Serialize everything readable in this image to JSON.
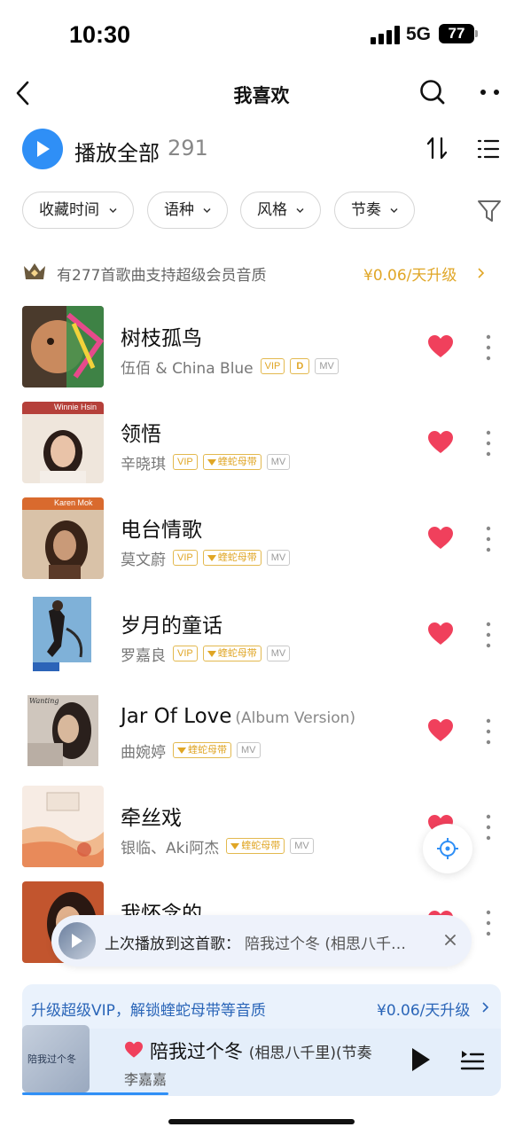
{
  "status_bar": {
    "time": "10:30",
    "network": "5G",
    "battery": "77"
  },
  "nav": {
    "title": "我喜欢",
    "back_icon": "chevron-left-icon",
    "search_icon": "search-icon",
    "more_icon": "more-dots-icon"
  },
  "play_all": {
    "label": "播放全部",
    "count": "291"
  },
  "filters": [
    {
      "label": "收藏时间"
    },
    {
      "label": "语种"
    },
    {
      "label": "风格"
    },
    {
      "label": "节奏"
    }
  ],
  "promo": {
    "text": "有277首歌曲支持超级会员音质",
    "price": "¥0.06/天升级"
  },
  "songs": [
    {
      "title": "树枝孤鸟",
      "version": "",
      "artist": "伍佰 & China Blue",
      "vip": "VIP",
      "quality": "",
      "dolby": "D",
      "mv": "MV"
    },
    {
      "title": "领悟",
      "version": "",
      "artist": "辛晓琪",
      "vip": "VIP",
      "quality": "蝰蛇母带",
      "mv": "MV"
    },
    {
      "title": "电台情歌",
      "version": "",
      "artist": "莫文蔚",
      "vip": "VIP",
      "quality": "蝰蛇母带",
      "mv": "MV"
    },
    {
      "title": "岁月的童话",
      "version": "",
      "artist": "罗嘉良",
      "vip": "VIP",
      "quality": "蝰蛇母带",
      "mv": "MV"
    },
    {
      "title": "Jar Of Love",
      "version": "(Album Version)",
      "artist": "曲婉婷",
      "vip": "",
      "quality": "蝰蛇母带",
      "mv": "MV"
    },
    {
      "title": "牵丝戏",
      "version": "",
      "artist": "银临、Aki阿杰",
      "vip": "",
      "quality": "蝰蛇母带",
      "mv": "MV"
    },
    {
      "title": "我怀念的",
      "version": "",
      "artist": "",
      "vip": "",
      "quality": "",
      "mv": ""
    }
  ],
  "cover_labels": {
    "song2": "Winnie Hsin",
    "song3": "Karen Mok",
    "song5": "Wanting"
  },
  "toast": {
    "label": "上次播放到这首歌：",
    "song": "陪我过个冬 (相思八千…"
  },
  "upgrade": {
    "text": "升级超级VIP，解锁蝰蛇母带等音质",
    "price": "¥0.06/天升级"
  },
  "mini_player": {
    "title": "陪我过个冬",
    "subtitle": "(相思八千里)(节奏",
    "artist": "李嘉嘉",
    "cover_text": "陪我过个冬"
  },
  "colors": {
    "accent": "#2f8ff6",
    "heart": "#f0405c",
    "gold": "#e0a626"
  }
}
